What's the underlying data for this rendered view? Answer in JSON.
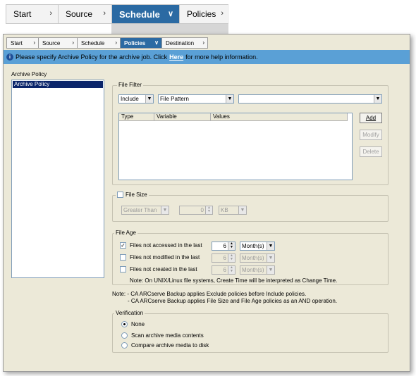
{
  "top_nav": {
    "items": [
      "Start",
      "Source",
      "Schedule",
      "Policies"
    ],
    "active": "Schedule"
  },
  "sub_nav": {
    "items": [
      "Start",
      "Source",
      "Schedule",
      "Policies",
      "Destination"
    ],
    "active": "Policies"
  },
  "info_bar": {
    "text_before": "Please specify Archive Policy for the archive job. Click",
    "link": "Here",
    "text_after": "for more help information."
  },
  "archive_policy": {
    "label": "Archive Policy",
    "items": [
      "Archive Policy"
    ]
  },
  "file_filter": {
    "title": "File Filter",
    "include_value": "Include",
    "type_value": "File Pattern",
    "pattern_value": "",
    "columns": [
      "Type",
      "Variable",
      "Values"
    ],
    "add_label": "Add",
    "modify_label": "Modify",
    "delete_label": "Delete"
  },
  "file_size": {
    "title": "File Size",
    "comparison_value": "Greater Than",
    "size_value": "0",
    "unit_value": "KB"
  },
  "file_age": {
    "title": "File Age",
    "rows": [
      {
        "label": "Files not accessed in the last",
        "checked": true,
        "number": "6",
        "unit": "Month(s)"
      },
      {
        "label": "Files not modified in the last",
        "checked": false,
        "number": "6",
        "unit": "Month(s)"
      },
      {
        "label": "Files not created in the last",
        "checked": false,
        "number": "6",
        "unit": "Month(s)"
      }
    ],
    "note": "Note: On UNIX/Linux file systems, Create Time will be interpreted as Change Time."
  },
  "notes": {
    "line1": "Note: - CA ARCserve Backup applies Exclude policies before Include policies.",
    "line2": "- CA ARCserve Backup applies File Size and File Age policies as an AND operation."
  },
  "verification": {
    "title": "Verification",
    "options": [
      "None",
      "Scan archive media contents",
      "Compare archive media to disk"
    ],
    "selected": "None"
  }
}
